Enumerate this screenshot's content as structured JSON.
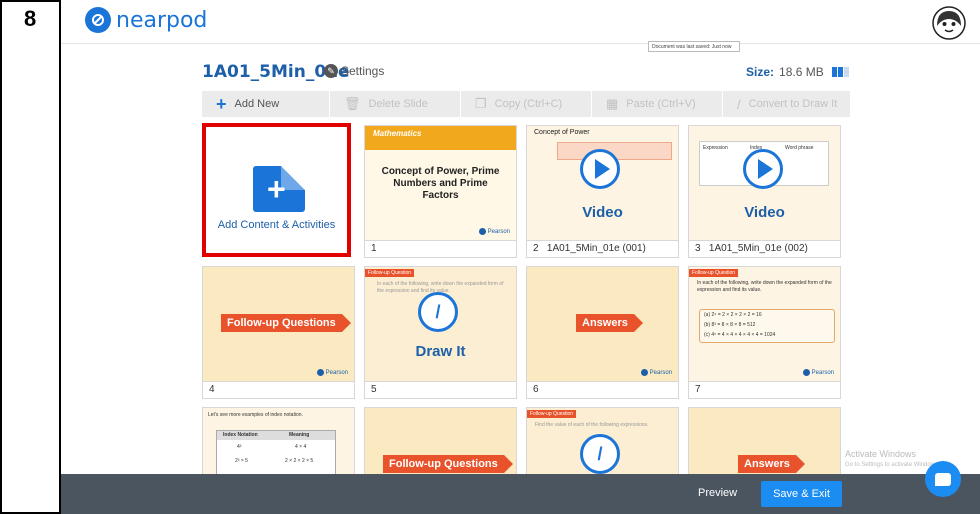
{
  "step": "8",
  "header": {
    "brand": "nearpod",
    "toast": "Document was last saved: Just now"
  },
  "lesson": {
    "title": "1A01_5Min_01e",
    "settings_label": "Settings",
    "size_label": "Size:",
    "size_value": "18.6 MB"
  },
  "toolbar": {
    "add_new": "Add New",
    "delete_slide": "Delete Slide",
    "copy": "Copy (Ctrl+C)",
    "paste": "Paste (Ctrl+V)",
    "convert": "Convert to Draw It"
  },
  "add_tile": {
    "label": "Add Content & Activities"
  },
  "slides": [
    {
      "number": "1",
      "heading": "Concept of Power, Prime Numbers and Prime Factors",
      "header_text": "Mathematics",
      "brand": "Pearson"
    },
    {
      "number": "2",
      "caption": "1A01_5Min_01e (001)",
      "type_label": "Video",
      "heading": "Concept of Power"
    },
    {
      "number": "3",
      "caption": "1A01_5Min_01e (002)",
      "type_label": "Video",
      "col1": "Expression",
      "col2": "Index",
      "col3": "Word phrase"
    },
    {
      "number": "4",
      "banner": "Follow-up Questions",
      "brand": "Pearson"
    },
    {
      "number": "5",
      "type_label": "Draw It",
      "small_banner": "Follow-up Question",
      "text": "In each of the following, write down the expanded form of the expression and find its value."
    },
    {
      "number": "6",
      "banner": "Answers",
      "brand": "Pearson"
    },
    {
      "number": "7",
      "small_banner": "Follow-up Question",
      "text": "In each of the following, write down the expanded form of the expression and find its value.",
      "line_a": "(a) 2⁴ = 2 × 2 × 2 × 2 = 16",
      "line_b": "(b) 8³ = 8 × 8 × 8 = 512",
      "line_c": "(c) 4⁵ = 4 × 4 × 4 × 4 × 4 = 1024",
      "brand": "Pearson"
    },
    {
      "text": "Let's see more examples of index notation.",
      "col1": "Index Notation",
      "col2": "Meaning",
      "r1a": "4²",
      "r1b": "4 × 4",
      "r2a": "2³ × 5",
      "r2b": "2 × 2 × 2 × 5"
    },
    {
      "banner": "Follow-up Questions"
    },
    {
      "small_banner": "Follow-up Question",
      "text": "Find the value of each of the following expressions."
    },
    {
      "banner": "Answers"
    }
  ],
  "footer": {
    "preview": "Preview",
    "save_exit": "Save & Exit"
  },
  "watermark": {
    "line1": "Activate Windows",
    "line2": "Go to Settings to activate Windows."
  },
  "colors": {
    "brand_blue": "#1b75d9",
    "highlight_red": "#e00000",
    "banner_orange": "#e8532c",
    "bottom_bar": "#4a5560"
  }
}
